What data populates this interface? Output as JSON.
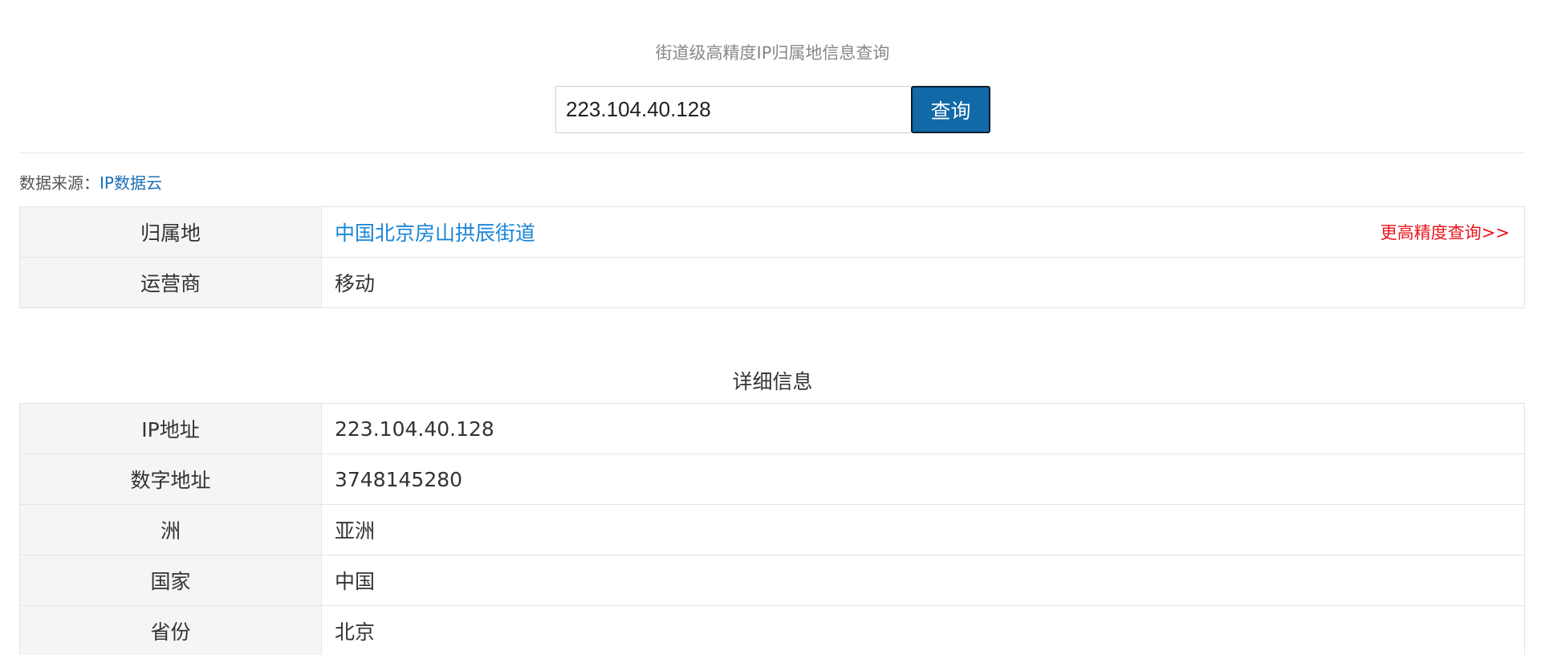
{
  "header": {
    "subtitle": "街道级高精度IP归属地信息查询"
  },
  "search": {
    "value": "223.104.40.128",
    "button_label": "查询"
  },
  "source": {
    "label": "数据来源：",
    "link_text": "IP数据云"
  },
  "summary": {
    "rows": [
      {
        "key": "归属地",
        "value": "中国北京房山拱辰街道",
        "action": "更高精度查询>>"
      },
      {
        "key": "运营商",
        "value": "移动"
      }
    ]
  },
  "details": {
    "title": "详细信息",
    "rows": [
      {
        "key": "IP地址",
        "value": "223.104.40.128"
      },
      {
        "key": "数字地址",
        "value": "3748145280"
      },
      {
        "key": "洲",
        "value": "亚洲"
      },
      {
        "key": "国家",
        "value": "中国"
      },
      {
        "key": "省份",
        "value": "北京"
      }
    ]
  },
  "colors": {
    "button": "#1169a8",
    "link": "#1a85d6",
    "action_link": "#e8141c",
    "key_cell_bg": "#f5f5f5"
  }
}
